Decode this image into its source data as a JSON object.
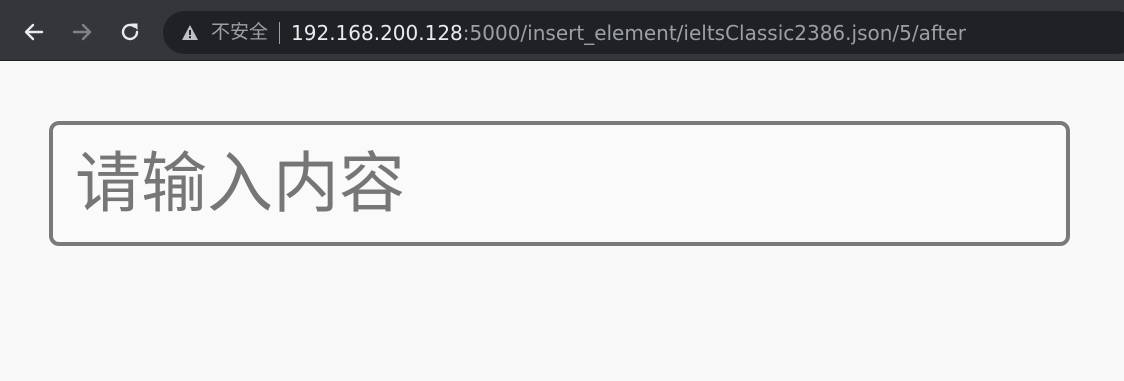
{
  "browser": {
    "nav": {
      "back_icon": "arrow-left-icon",
      "forward_icon": "arrow-right-icon",
      "reload_icon": "reload-icon"
    },
    "address_bar": {
      "security_icon": "warning-triangle-icon",
      "security_label": "不安全",
      "url_host": "192.168.200.128",
      "url_rest": ":5000/insert_element/ieltsClassic2386.json/5/after"
    },
    "colors": {
      "toolbar_bg": "#35363a",
      "omnibox_bg": "#202124",
      "url_host": "#e8eaed",
      "url_muted": "#9aa0a6"
    }
  },
  "page": {
    "input": {
      "value": "",
      "placeholder": "请输入内容"
    },
    "colors": {
      "background": "#f9f9f9",
      "input_border": "#7a7a7a",
      "placeholder": "#767676"
    }
  }
}
